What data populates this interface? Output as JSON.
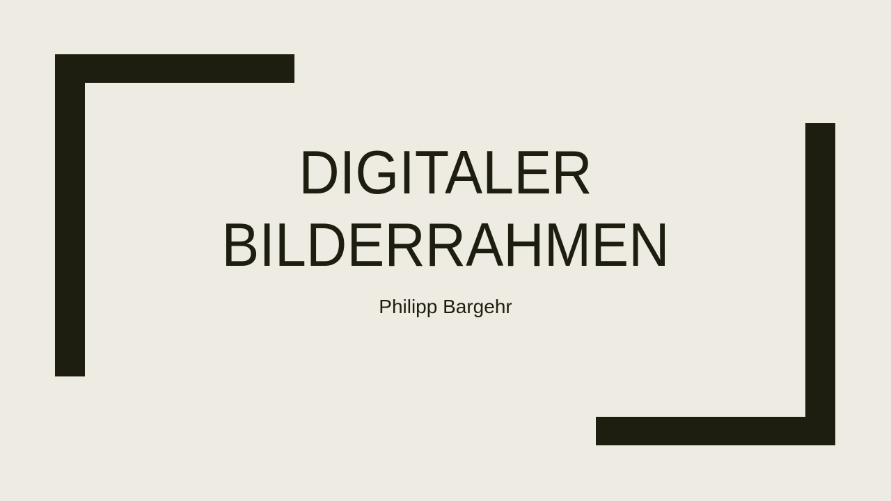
{
  "slide": {
    "title_line1": "DIGITALER",
    "title_line2": "BILDERRAHMEN",
    "subtitle": "Philipp Bargehr"
  },
  "colors": {
    "background": "#eeebe3",
    "accent": "#1d1e10"
  }
}
